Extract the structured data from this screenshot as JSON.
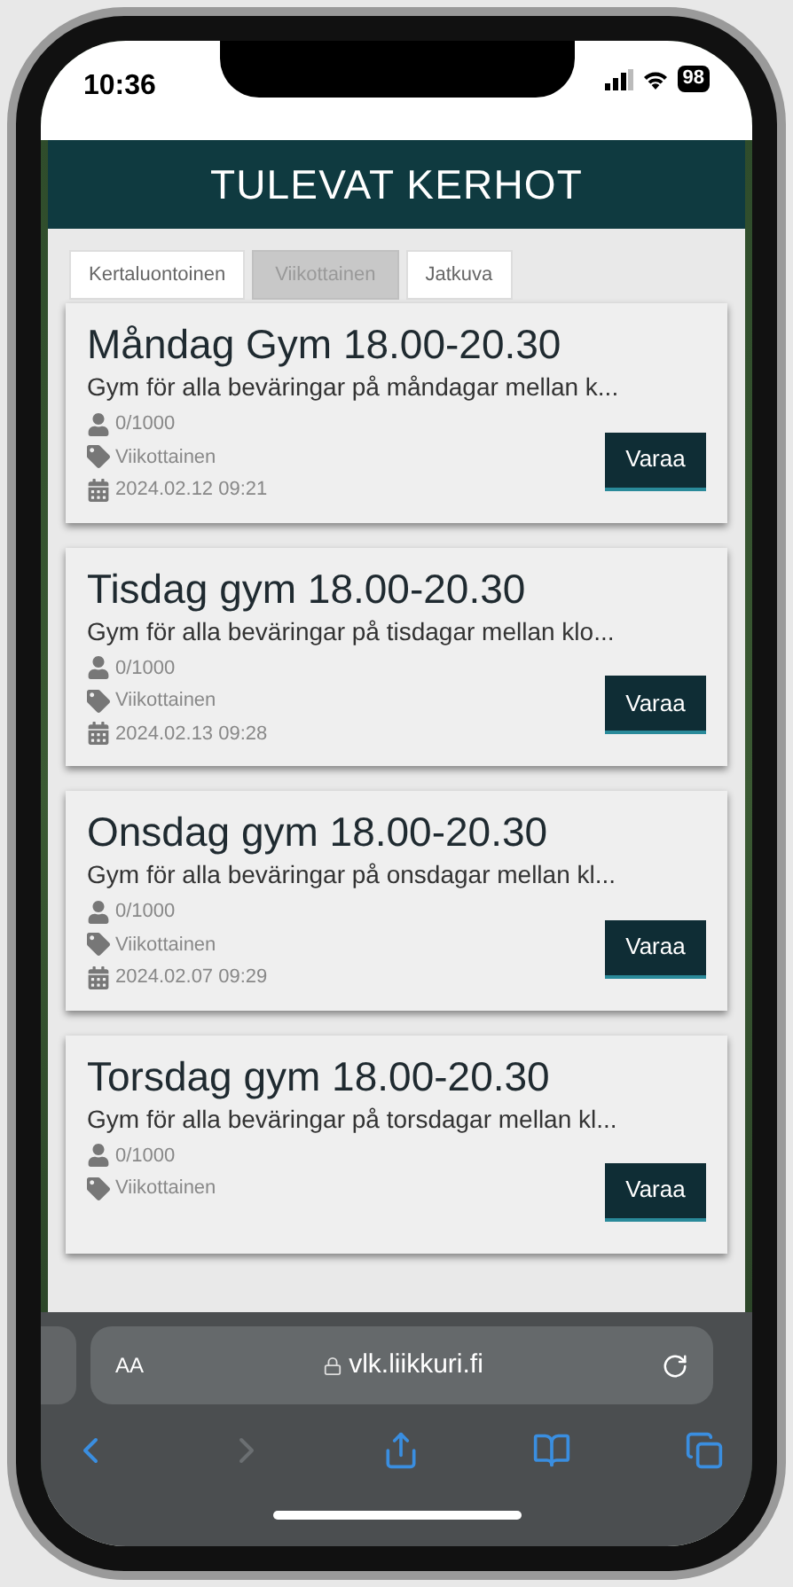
{
  "status_bar": {
    "time": "10:36",
    "battery": "98"
  },
  "header": {
    "title": "TULEVAT KERHOT"
  },
  "tabs": [
    {
      "label": "Kertaluontoinen",
      "selected": false
    },
    {
      "label": "Viikottainen",
      "selected": true
    },
    {
      "label": "Jatkuva",
      "selected": false
    }
  ],
  "cards": [
    {
      "title": "Måndag Gym 18.00-20.30",
      "description": "Gym för alla beväringar på måndagar mellan k...",
      "participants": "0/1000",
      "type": "Viikottainen",
      "date": "2024.02.12 09:21",
      "button": "Varaa"
    },
    {
      "title": "Tisdag gym 18.00-20.30",
      "description": "Gym för alla beväringar på tisdagar mellan klo...",
      "participants": "0/1000",
      "type": "Viikottainen",
      "date": "2024.02.13 09:28",
      "button": "Varaa"
    },
    {
      "title": "Onsdag gym 18.00-20.30",
      "description": "Gym för alla beväringar på onsdagar mellan kl...",
      "participants": "0/1000",
      "type": "Viikottainen",
      "date": "2024.02.07 09:29",
      "button": "Varaa"
    },
    {
      "title": "Torsdag gym 18.00-20.30",
      "description": "Gym för alla beväringar på torsdagar mellan kl...",
      "participants": "0/1000",
      "type": "Viikottainen",
      "button": "Varaa"
    }
  ],
  "browser": {
    "text_size": "AA",
    "url": "vlk.liikkuri.fi",
    "back": {
      "disabled": false
    },
    "forward": {
      "disabled": true
    }
  }
}
